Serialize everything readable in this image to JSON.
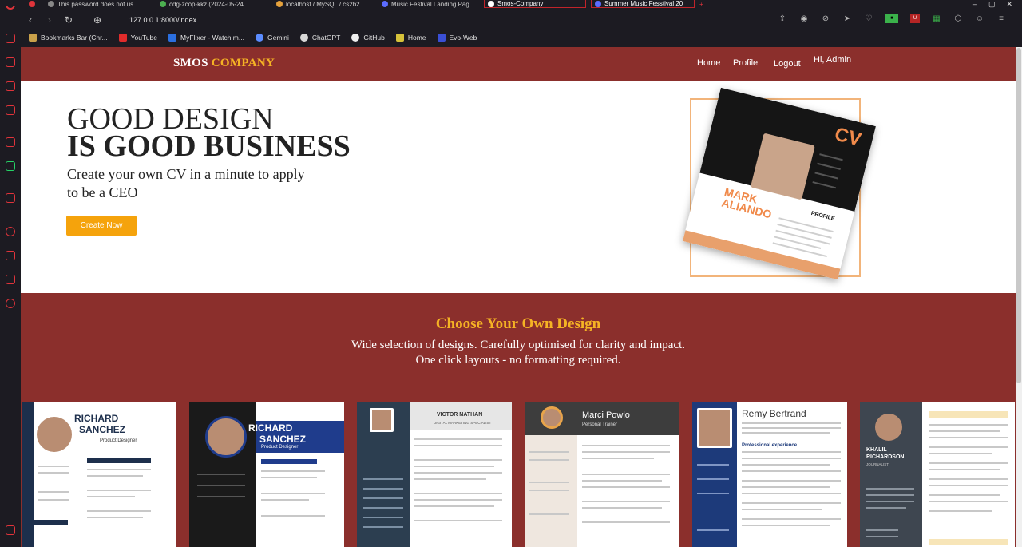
{
  "browser": {
    "tabs": [
      {
        "title": "This password does not us"
      },
      {
        "title": "cdg-zcop-kkz (2024-05-24"
      },
      {
        "title": "localhost / MySQL / cs2b2"
      },
      {
        "title": "Music Festival Landing Pag"
      },
      {
        "title": "Smos-Company"
      },
      {
        "title": "Summer Music Fesstival 20"
      }
    ],
    "new_tab": "+",
    "url": "127.0.0.1:8000/index",
    "bookmarks": [
      {
        "label": "Bookmarks Bar (Chr...",
        "color": "#c9a14a"
      },
      {
        "label": "YouTube",
        "color": "#e02b2b"
      },
      {
        "label": "MyFlixer - Watch m...",
        "color": "#2b6fe0"
      },
      {
        "label": "Gemini",
        "color": "#5b8cff"
      },
      {
        "label": "ChatGPT",
        "color": "#d8d8d8"
      },
      {
        "label": "GitHub",
        "color": "#f0f0f0"
      },
      {
        "label": "Home",
        "color": "#d6c23a"
      },
      {
        "label": "Evo-Web",
        "color": "#3a4fd6"
      }
    ]
  },
  "site": {
    "brand_main": "SMOS",
    "brand_accent": "COMPANY",
    "nav": {
      "home": "Home",
      "profile": "Profile",
      "logout": "Logout",
      "greeting": "Hi, Admin"
    },
    "hero": {
      "line1": "GOOD DESIGN",
      "line2": "IS GOOD BUSINESS",
      "subtitle": "Create your own CV in a minute to apply to be a CEO",
      "cta": "Create Now"
    },
    "cv_art": {
      "tag": "CV",
      "name_line1": "MARK",
      "name_line2": "ALIANDO",
      "profile": "PROFILE"
    },
    "designs": {
      "title": "Choose Your Own Design",
      "subtitle_line1": "Wide selection of designs. Carefully optimised for clarity and impact.",
      "subtitle_line2": "One click layouts - no formatting required.",
      "cards": [
        {
          "name_line1": "RICHARD",
          "name_line2": "SANCHEZ",
          "role": "Product Designer"
        },
        {
          "name_line1": "RICHARD",
          "name_line2": "SANCHEZ",
          "role": "Product Designer"
        },
        {
          "name_line1": "VICTOR NATHAN",
          "name_line2": "",
          "role": "DIGITAL MARKETING SPECIALIST"
        },
        {
          "name_line1": "Marci Powlo",
          "name_line2": "",
          "role": "Personal Trainer"
        },
        {
          "name_line1": "Remy Bertrand",
          "name_line2": "",
          "role": "Professional experience"
        },
        {
          "name_line1": "KHALIL",
          "name_line2": "RICHARDSON",
          "role": "JOURNALIST"
        }
      ]
    }
  },
  "colors": {
    "brand_red": "#8b2f2c",
    "accent_gold": "#f5b324",
    "cta_orange": "#f5a30c"
  }
}
